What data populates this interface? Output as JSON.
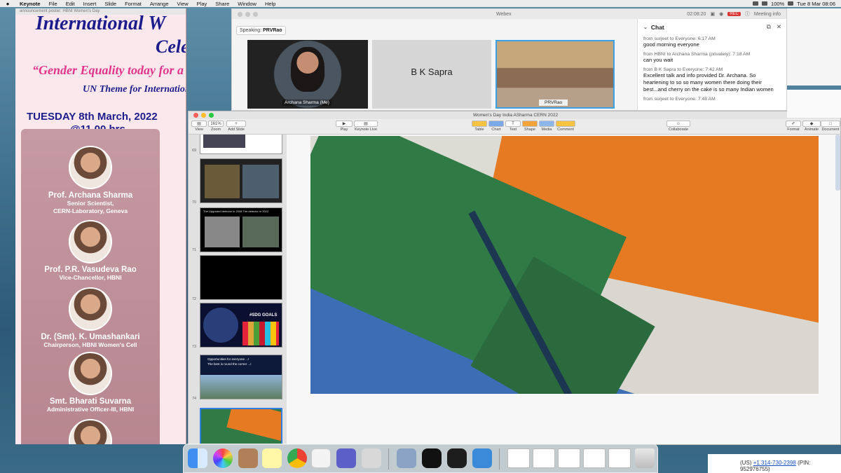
{
  "menubar": {
    "app": "Keynote",
    "items": [
      "File",
      "Edit",
      "Insert",
      "Slide",
      "Format",
      "Arrange",
      "View",
      "Play",
      "Share",
      "Window",
      "Help"
    ],
    "battery": "100%",
    "clock": "Tue 8 Mar 08:06"
  },
  "poster": {
    "window_title": "announcement poster: HBNI Women's Day",
    "title_line1": "International W",
    "title_line2": "Celebra",
    "quote": "“Gender Equality today for a",
    "theme": "UN Theme for International",
    "date": "TUESDAY 8th March, 2022",
    "time": "@11.00 hrs",
    "speakers": [
      {
        "name": "Prof. Archana Sharma",
        "role1": "Senior Scientist,",
        "role2": "CERN-Laboratory, Geneva"
      },
      {
        "name": "Prof. P.R. Vasudeva Rao",
        "role1": "Vice-Chancellor, HBNI",
        "role2": ""
      },
      {
        "name": "Dr. (Smt). K. Umashankari",
        "role1": "Chairperson, HBNI Women's Cell",
        "role2": ""
      },
      {
        "name": "Smt. Bharati Suvarna",
        "role1": "Administrative Officer-III, HBNI",
        "role2": ""
      }
    ]
  },
  "webex": {
    "title": "Webex",
    "timer": "02:08:20",
    "rec": "REC",
    "meeting_info": "Meeting info",
    "speaking_label": "Speaking:",
    "speaking_name": "PRVRao",
    "tiles": [
      {
        "label": "Archana Sharma  (Me)"
      },
      {
        "label": "B K Sapra"
      },
      {
        "label": "PRVRao"
      }
    ],
    "chat": {
      "title": "Chat",
      "messages": [
        {
          "from": "from surjeet to Everyone:   6:17  AM",
          "text": "good morning everyone"
        },
        {
          "from": "from HBNI to Archana Sharma (privately):   7:18  AM",
          "text": "can you wait"
        },
        {
          "from": "from B K Sapra to Everyone:   7:42  AM",
          "text": "Excellent talk and info provided Dr. Archana. So heartening to so so many women there doing their best...and cherry on the cake is so many Indian women"
        },
        {
          "from": "from surjeet to Everyone:   7:48  AM",
          "text": ""
        }
      ]
    }
  },
  "keynote": {
    "title": "Women's Day India ASharma CERN 2022",
    "zoom": "161%",
    "toolbar": {
      "view": "View",
      "zoom": "Zoom",
      "add_slide": "Add Slide",
      "play": "Play",
      "keynote_live": "Keynote Live",
      "table": "Table",
      "chart": "Chart",
      "text": "Text",
      "shape": "Shape",
      "media": "Media",
      "comment": "Comment",
      "collaborate": "Collaborate",
      "format": "Format",
      "animate": "Animate",
      "document": "Document"
    },
    "slides": [
      {
        "num": "69"
      },
      {
        "num": "70"
      },
      {
        "num": "71"
      },
      {
        "num": "72"
      },
      {
        "num": "73"
      },
      {
        "num": "74"
      },
      {
        "num": "75"
      }
    ],
    "thumb_texts": {
      "t71": "The Upgraded detector in 2008    The detector in 2022",
      "t73": "#SDG GOALS",
      "t74a": "Opportunities for everyone ...!",
      "t74b": "The best is round the corner ...!"
    }
  },
  "dial": {
    "prefix": "(US)",
    "number": "+1 314-730-2398",
    "pin": "(PIN: 952976755)"
  }
}
